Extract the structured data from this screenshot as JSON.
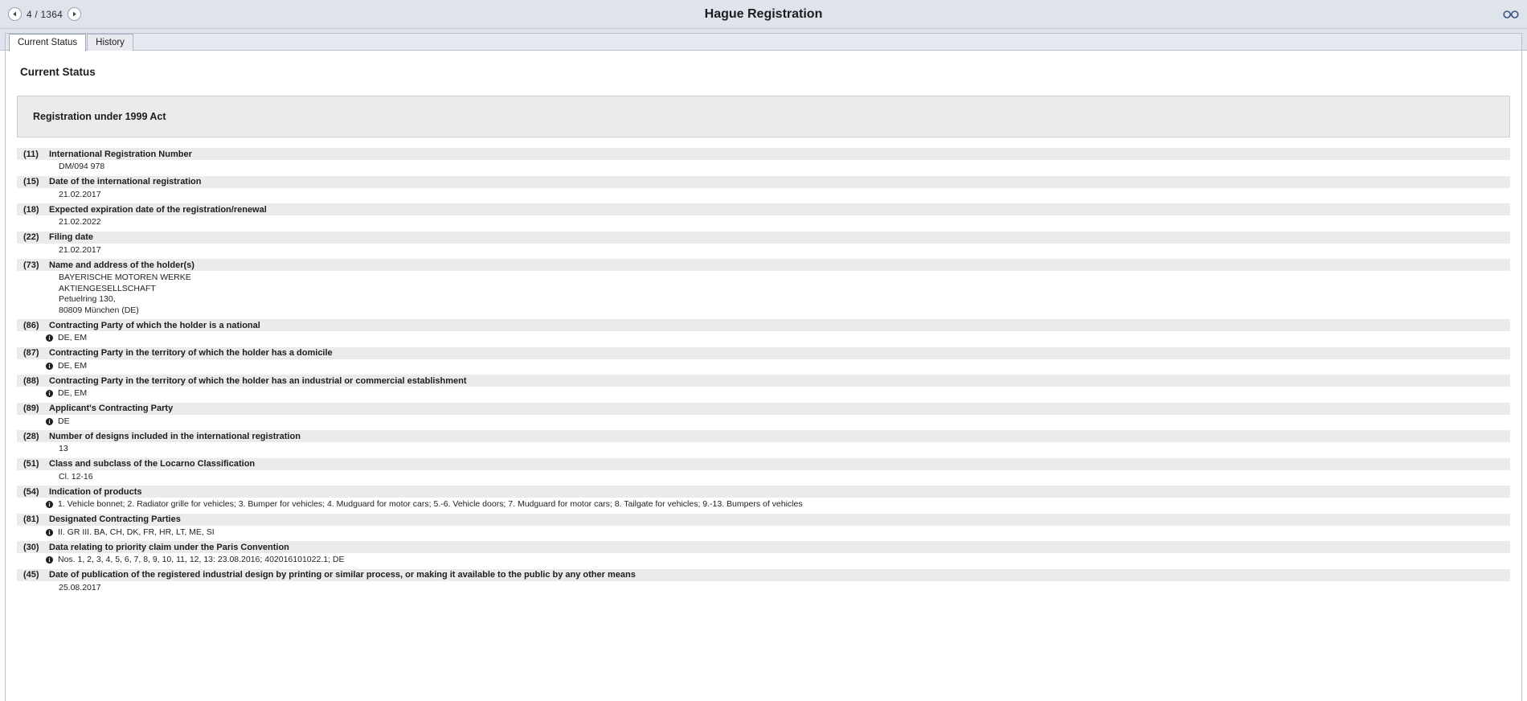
{
  "header": {
    "title": "Hague Registration",
    "pager": {
      "prev_icon": "chevron-left-icon",
      "next_icon": "chevron-right-icon",
      "current": 4,
      "total": 1364,
      "counter_text": "4 / 1364"
    },
    "tools": {
      "glasses_icon": "glasses-icon"
    }
  },
  "tabs": [
    {
      "label": "Current Status",
      "active": true
    },
    {
      "label": "History",
      "active": false
    }
  ],
  "page": {
    "heading": "Current Status",
    "section_title": "Registration under 1999 Act"
  },
  "fields": [
    {
      "code": "(11)",
      "label": "International Registration Number",
      "values": [
        {
          "text": "DM/094 978",
          "icon": null
        }
      ]
    },
    {
      "code": "(15)",
      "label": "Date of the international registration",
      "values": [
        {
          "text": "21.02.2017",
          "icon": null
        }
      ]
    },
    {
      "code": "(18)",
      "label": "Expected expiration date of the registration/renewal",
      "values": [
        {
          "text": "21.02.2022",
          "icon": null
        }
      ]
    },
    {
      "code": "(22)",
      "label": "Filing date",
      "values": [
        {
          "text": "21.02.2017",
          "icon": null
        }
      ]
    },
    {
      "code": "(73)",
      "label": "Name and address of the holder(s)",
      "values": [
        {
          "text": "BAYERISCHE MOTOREN WERKE",
          "icon": null
        },
        {
          "text": "AKTIENGESELLSCHAFT",
          "icon": null
        },
        {
          "text": "Petuelring 130,",
          "icon": null
        },
        {
          "text": "80809 München (DE)",
          "icon": null
        }
      ]
    },
    {
      "code": "(86)",
      "label": "Contracting Party of which the holder is a national",
      "values": [
        {
          "text": "DE, EM",
          "icon": "info-icon"
        }
      ]
    },
    {
      "code": "(87)",
      "label": "Contracting Party in the territory of which the holder has a domicile",
      "values": [
        {
          "text": "DE, EM",
          "icon": "info-icon"
        }
      ]
    },
    {
      "code": "(88)",
      "label": "Contracting Party in the territory of which the holder has an industrial or commercial establishment",
      "values": [
        {
          "text": "DE, EM",
          "icon": "info-icon"
        }
      ]
    },
    {
      "code": "(89)",
      "label": "Applicant's Contracting Party",
      "values": [
        {
          "text": "DE",
          "icon": "info-icon"
        }
      ]
    },
    {
      "code": "(28)",
      "label": "Number of designs included in the international registration",
      "values": [
        {
          "text": "13",
          "icon": null
        }
      ]
    },
    {
      "code": "(51)",
      "label": "Class and subclass of the Locarno Classification",
      "values": [
        {
          "text": "Cl. 12-16",
          "icon": null
        }
      ]
    },
    {
      "code": "(54)",
      "label": "Indication of products",
      "values": [
        {
          "text": "1. Vehicle bonnet; 2. Radiator grille for vehicles; 3. Bumper for vehicles; 4. Mudguard for motor cars; 5.-6. Vehicle doors; 7. Mudguard for motor cars; 8. Tailgate for vehicles; 9.-13. Bumpers of vehicles",
          "icon": "info-icon"
        }
      ]
    },
    {
      "code": "(81)",
      "label": "Designated Contracting Parties",
      "values": [
        {
          "text": "II. GR III. BA, CH, DK, FR, HR, LT, ME, SI",
          "icon": "info-icon"
        }
      ]
    },
    {
      "code": "(30)",
      "label": "Data relating to priority claim under the Paris Convention",
      "values": [
        {
          "text": "Nos. 1, 2, 3, 4, 5, 6, 7, 8, 9, 10, 11, 12, 13: 23.08.2016; 402016101022.1; DE",
          "icon": "info-icon"
        }
      ]
    },
    {
      "code": "(45)",
      "label": "Date of publication of the registered industrial design by printing or similar process, or making it available to the public by any other means",
      "values": [
        {
          "text": "25.08.2017",
          "icon": null
        }
      ]
    }
  ],
  "colors": {
    "topbar_bg": "#dfe3eb",
    "row_bg": "#ebebeb",
    "panel_bg": "#ffffff",
    "text": "#1d1d1d",
    "icon_blue": "#3a5f8a"
  }
}
